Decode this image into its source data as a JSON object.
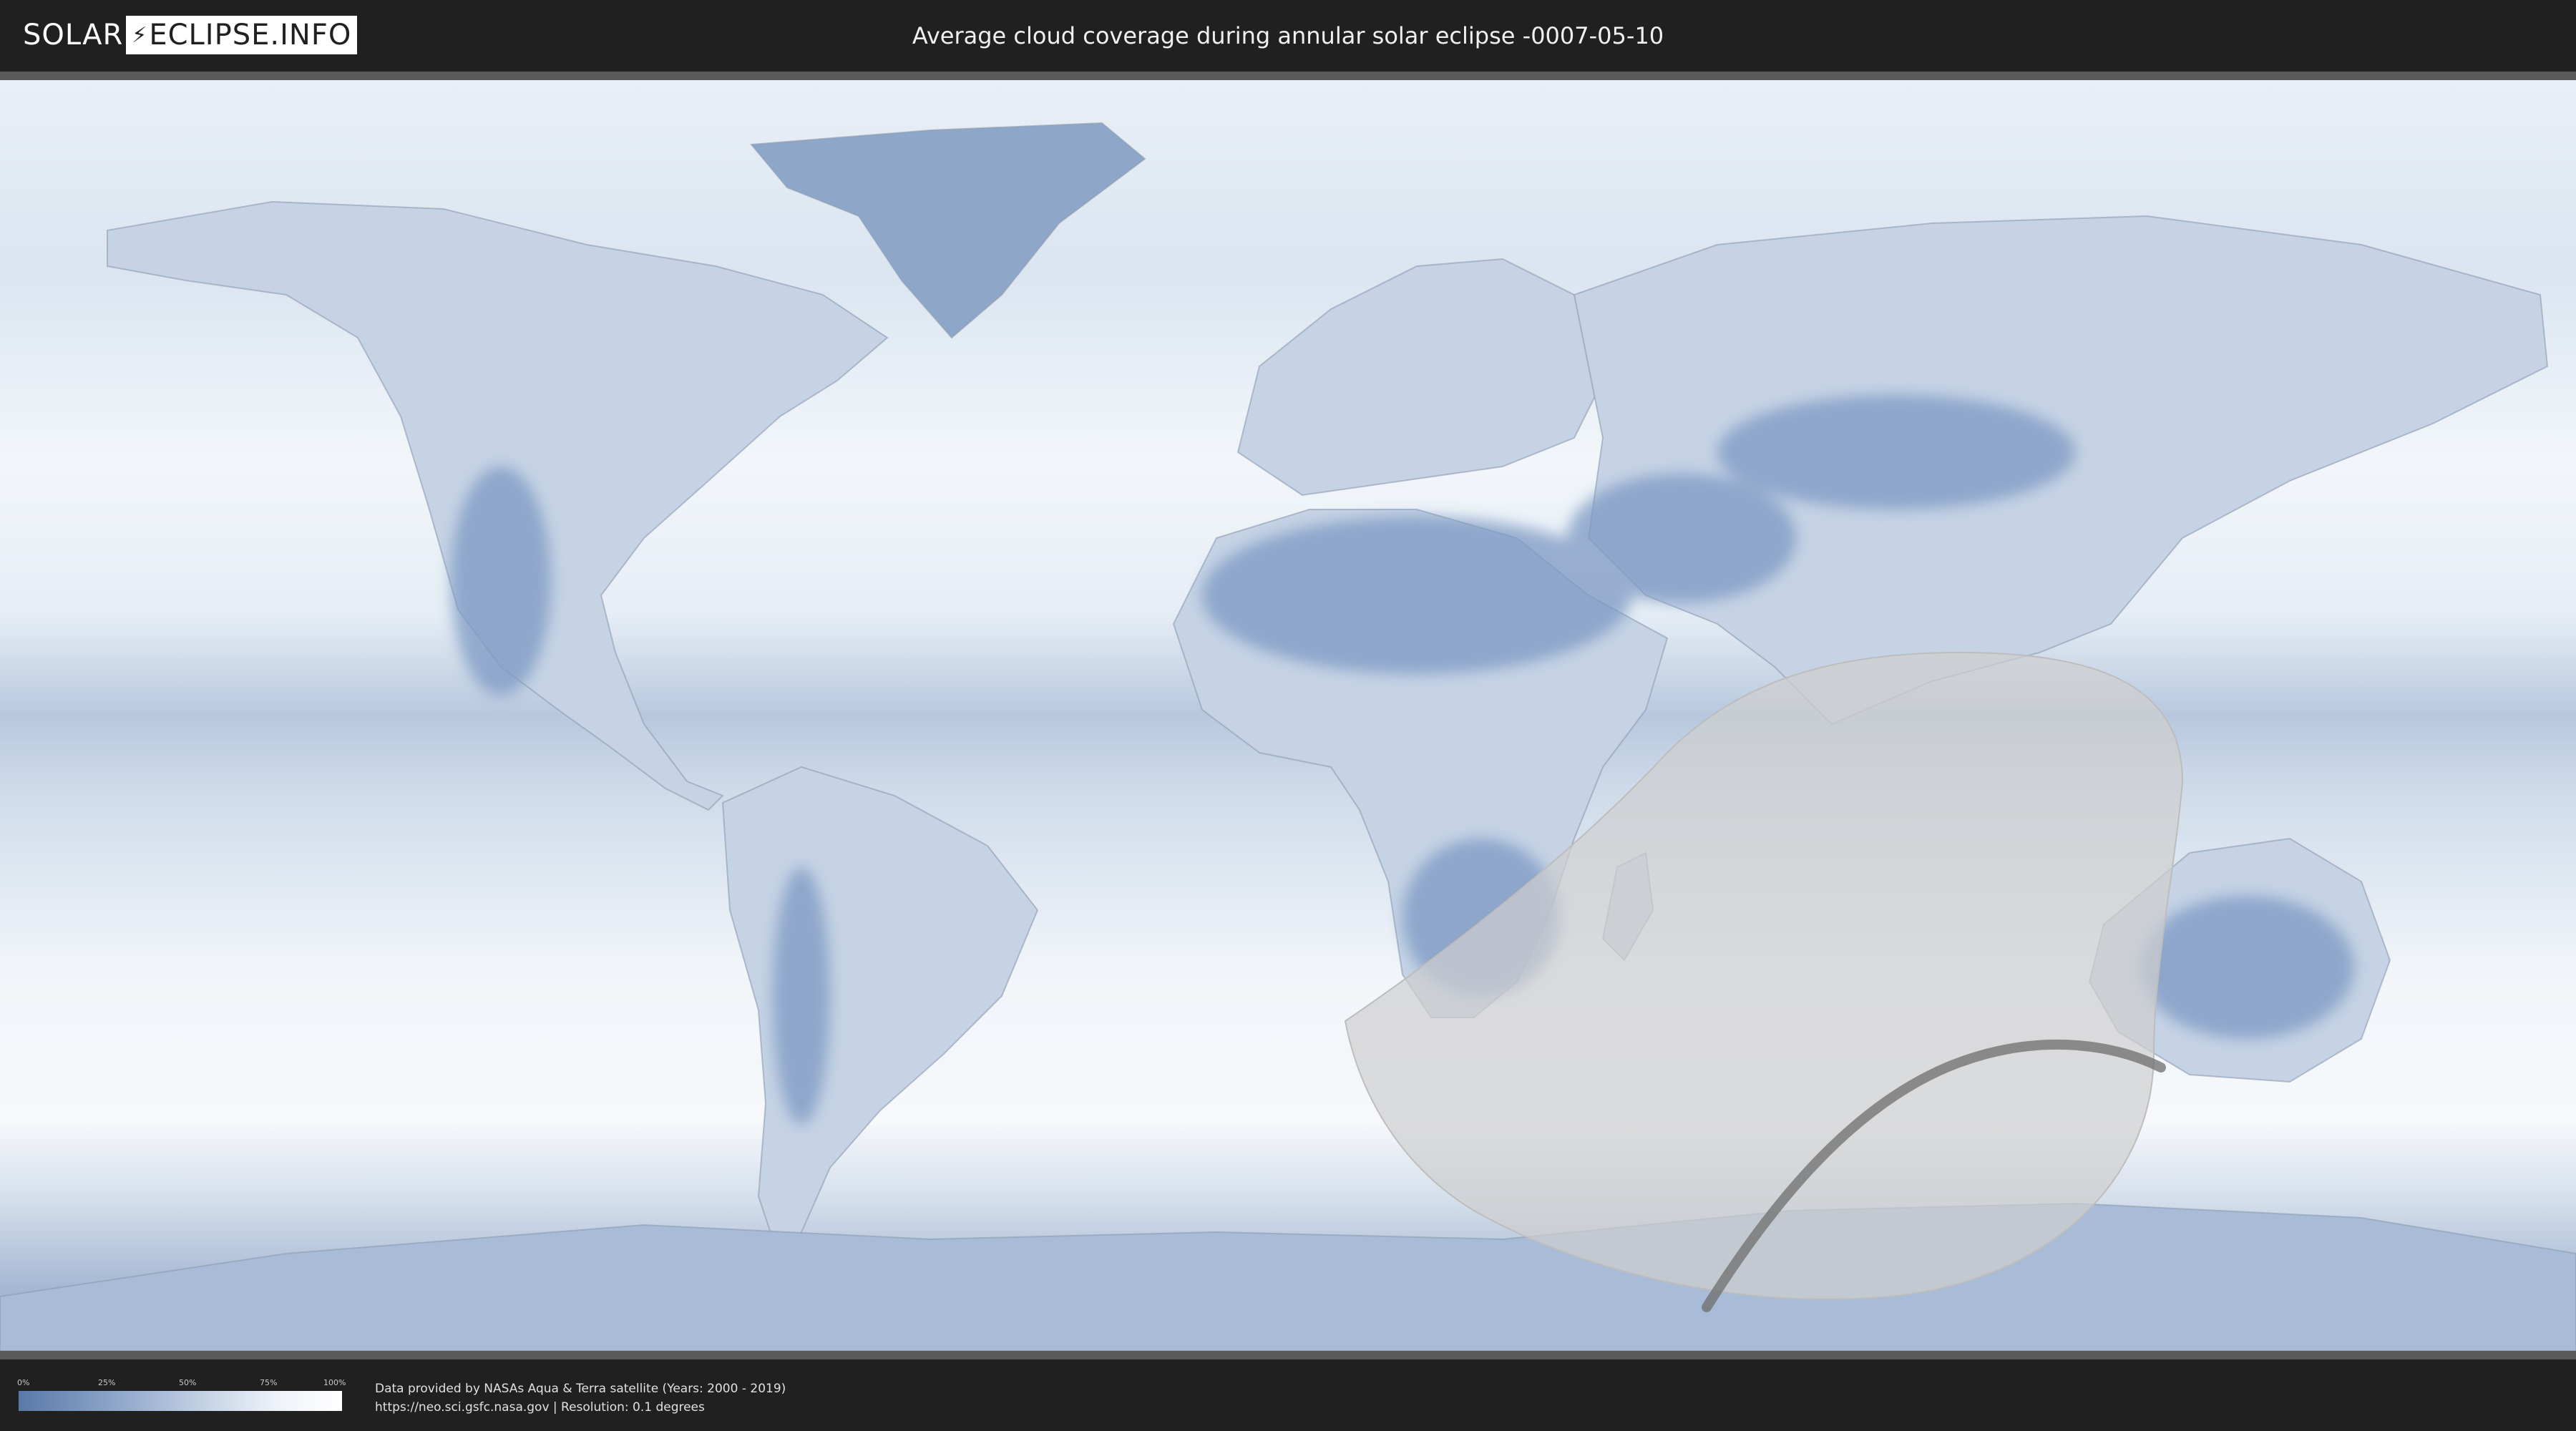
{
  "header": {
    "logo_left": "SOLAR",
    "logo_right": "ECLIPSE.INFO",
    "title": "Average cloud coverage during annular solar eclipse -0007-05-10"
  },
  "legend": {
    "ticks": [
      {
        "label": "0%",
        "fraction": 0.0
      },
      {
        "label": "25%",
        "fraction": 0.25
      },
      {
        "label": "50%",
        "fraction": 0.5
      },
      {
        "label": "75%",
        "fraction": 0.75
      },
      {
        "label": "100%",
        "fraction": 1.0
      }
    ],
    "colors": {
      "low": "#5a79a8",
      "high": "#ffffff"
    }
  },
  "credits": {
    "line1": "Data provided by NASAs Aqua & Terra satellite (Years: 2000 - 2019)",
    "line2": "https://neo.sci.gsfc.nasa.gov | Resolution: 0.1 degrees"
  },
  "colors": {
    "background": "#202020",
    "cloud_clear": "#5a79a8",
    "cloud_full": "#ffffff",
    "eclipse_zone": "#cfcfcf",
    "central_path": "#6e6e6e"
  }
}
